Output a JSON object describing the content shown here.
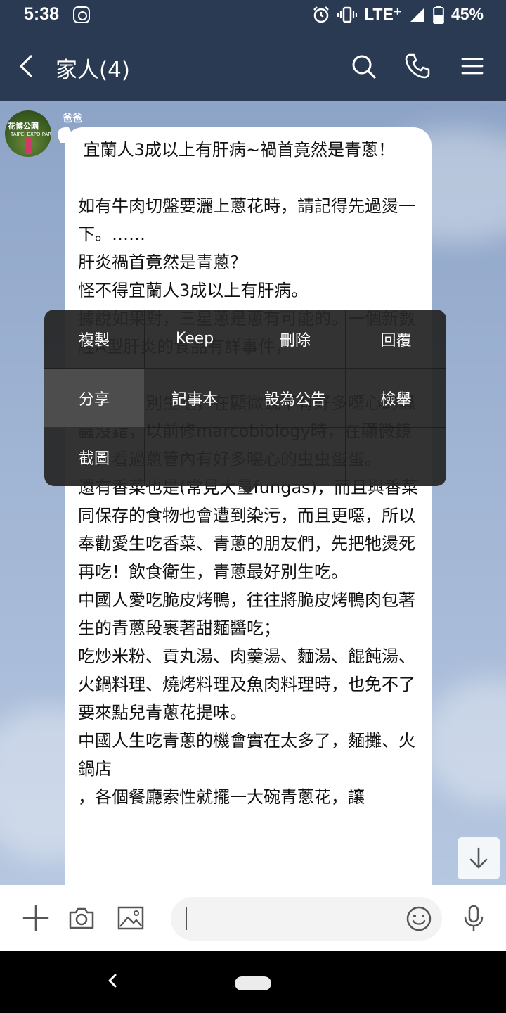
{
  "status_bar": {
    "time": "5:38",
    "network": "LTE⁺",
    "battery": "45%",
    "icons": [
      "instagram-icon",
      "alarm-icon",
      "vibrate-icon",
      "signal-icon",
      "battery-icon"
    ]
  },
  "header": {
    "title": "家人(4)",
    "icons": [
      "back-icon",
      "search-icon",
      "phone-icon",
      "menu-icon"
    ]
  },
  "message": {
    "sender": "爸爸",
    "avatar_text": "花博公園",
    "avatar_subtext": "TAIPEI EXPO PARK",
    "text": " 宜蘭人3成以上有肝病~禍首竟然是青蔥！\n\n如有牛肉切盤要灑上蔥花時，請記得先過燙一下。……\n肝炎禍首竟然是青蔥？\n怪不得宜蘭人3成以上有肝病。\n據說如果對，三星蔥是蔥有可能的。一個新數經A型肝炎的食品有詳事件，\n一……\n青蔥最好別生吃，在顯微鏡下有好多噁心的蟲蟲沒錯，以前修marcobiology時，在顯微鏡下，看過蔥管內有好多噁心的虫虫蛋蛋。\n還有香菜也是(常見大量fungas)，而且與香菜同保存的食物也會遭到染污，而且更噁，所以奉勸愛生吃香菜、青蔥的朋友們，先把牠燙死再吃！飲食衛生，青蔥最好別生吃。\n中國人愛吃脆皮烤鴨，往往將脆皮烤鴨肉包著生的青蔥段裹著甜麵醬吃；\n吃炒米粉、貢丸湯、肉羹湯、麵湯、餛飩湯、火鍋料理、燒烤料理及魚肉料理時，也免不了要來點兒青蔥花提味。\n中國人生吃青蔥的機會實在太多了，麵攤、火鍋店\n，各個餐廳索性就擺一大碗青蔥花，讓"
  },
  "context_menu": {
    "items": [
      "複製",
      "Keep",
      "刪除",
      "回覆",
      "分享",
      "記事本",
      "設為公告",
      "檢舉",
      "截圖"
    ],
    "highlighted": "分享"
  },
  "input_bar": {
    "placeholder": "",
    "icons": [
      "plus-icon",
      "camera-icon",
      "image-icon",
      "emoji-icon",
      "microphone-icon"
    ]
  },
  "scroll_button_icon": "arrow-down-icon",
  "navigation": {
    "icons": [
      "nav-back-icon",
      "nav-home-pill"
    ]
  },
  "colors": {
    "header_bg": "#2a3a52",
    "chat_bg": "#9cb1d1",
    "bubble_bg": "#ffffff",
    "menu_bg": "#262626",
    "menu_highlight": "#4d4d4d"
  }
}
